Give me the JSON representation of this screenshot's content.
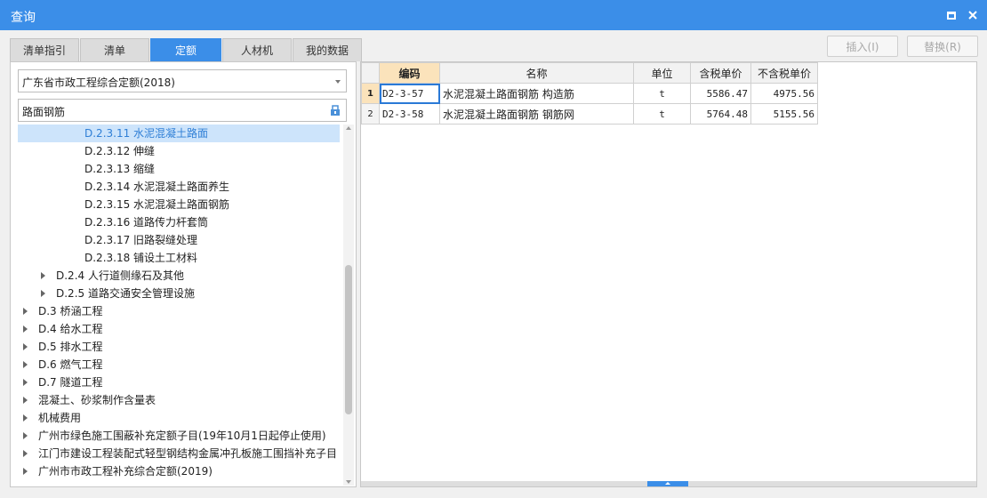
{
  "window": {
    "title": "查询"
  },
  "tabs": [
    {
      "label": "清单指引",
      "active": false
    },
    {
      "label": "清单",
      "active": false
    },
    {
      "label": "定额",
      "active": true
    },
    {
      "label": "人材机",
      "active": false
    },
    {
      "label": "我的数据",
      "active": false
    }
  ],
  "toolbar": {
    "insert_label": "插入(I)",
    "replace_label": "替换(R)"
  },
  "left": {
    "quota_select": {
      "value": "广东省市政工程综合定额(2018)"
    },
    "search": {
      "value": "路面钢筋"
    },
    "tree": [
      {
        "label": "D.2.3.11 水泥混凝土路面",
        "level": 3,
        "expandable": false,
        "selected": true
      },
      {
        "label": "D.2.3.12 伸缝",
        "level": 3,
        "expandable": false
      },
      {
        "label": "D.2.3.13 缩缝",
        "level": 3,
        "expandable": false
      },
      {
        "label": "D.2.3.14 水泥混凝土路面养生",
        "level": 3,
        "expandable": false
      },
      {
        "label": "D.2.3.15 水泥混凝土路面钢筋",
        "level": 3,
        "expandable": false
      },
      {
        "label": "D.2.3.16 道路传力杆套筒",
        "level": 3,
        "expandable": false
      },
      {
        "label": "D.2.3.17 旧路裂缝处理",
        "level": 3,
        "expandable": false
      },
      {
        "label": "D.2.3.18 铺设土工材料",
        "level": 3,
        "expandable": false
      },
      {
        "label": "D.2.4 人行道侧缘石及其他",
        "level": 2,
        "expandable": true
      },
      {
        "label": "D.2.5 道路交通安全管理设施",
        "level": 2,
        "expandable": true
      },
      {
        "label": "D.3 桥涵工程",
        "level": 1,
        "expandable": true
      },
      {
        "label": "D.4 给水工程",
        "level": 1,
        "expandable": true
      },
      {
        "label": "D.5 排水工程",
        "level": 1,
        "expandable": true
      },
      {
        "label": "D.6 燃气工程",
        "level": 1,
        "expandable": true
      },
      {
        "label": "D.7 隧道工程",
        "level": 1,
        "expandable": true
      },
      {
        "label": "混凝土、砂浆制作含量表",
        "level": 1,
        "expandable": true
      },
      {
        "label": "机械费用",
        "level": 1,
        "expandable": true
      },
      {
        "label": "广州市绿色施工围蔽补充定额子目(19年10月1日起停止使用)",
        "level": 1,
        "expandable": true
      },
      {
        "label": "江门市建设工程装配式轻型钢结构金属冲孔板施工围挡补充子目",
        "level": 1,
        "expandable": true
      },
      {
        "label": "广州市市政工程补充综合定额(2019)",
        "level": 1,
        "expandable": true
      }
    ]
  },
  "grid": {
    "columns": [
      "编码",
      "名称",
      "单位",
      "含税单价",
      "不含税单价"
    ],
    "rows": [
      {
        "index": "1",
        "code": "D2-3-57",
        "name": "水泥混凝土路面钢筋 构造筋",
        "unit": "t",
        "price_tax": "5586.47",
        "price_notax": "4975.56"
      },
      {
        "index": "2",
        "code": "D2-3-58",
        "name": "水泥混凝土路面钢筋 钢筋网",
        "unit": "t",
        "price_tax": "5764.48",
        "price_notax": "5155.56"
      }
    ]
  },
  "icons": {
    "search_button": "search-book-icon",
    "window_maximize": "maximize-icon",
    "window_close": "close-icon"
  },
  "colors": {
    "accent": "#3b8ee8",
    "selected_row": "#cde4fb",
    "header_highlight": "#fbe3bb"
  }
}
